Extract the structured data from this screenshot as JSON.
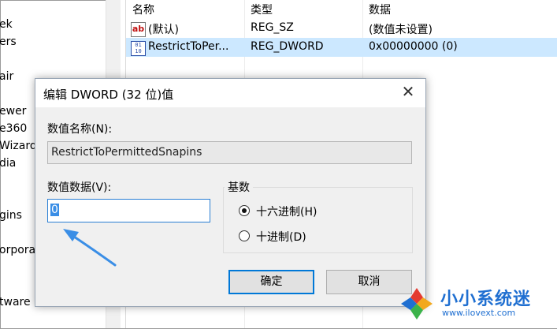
{
  "tree": {
    "items": [
      "ek",
      "ers",
      "air",
      "ewer",
      "e360",
      "Wizard",
      "dia",
      "gins",
      "orporat",
      "tware"
    ]
  },
  "list": {
    "columns": [
      "名称",
      "类型",
      "数据"
    ],
    "rows": [
      {
        "icon": "string-value-icon",
        "name": "(默认)",
        "type": "REG_SZ",
        "data": "(数值未设置)",
        "selected": false
      },
      {
        "icon": "binary-value-icon",
        "name": "RestrictToPer...",
        "type": "REG_DWORD",
        "data": "0x00000000 (0)",
        "selected": true
      }
    ]
  },
  "dialog": {
    "title": "编辑 DWORD (32 位)值",
    "close_glyph": "✕",
    "value_name_label": "数值名称(N):",
    "value_name": "RestrictToPermittedSnapins",
    "value_data_label": "数值数据(V):",
    "value_data": "0",
    "base_label": "基数",
    "radios": [
      {
        "label": "十六进制(H)",
        "checked": true
      },
      {
        "label": "十进制(D)",
        "checked": false
      }
    ],
    "ok_label": "确定",
    "cancel_label": "取消"
  },
  "watermark": {
    "name": "小小系统迷",
    "url": "www.ilovext.com"
  },
  "colors": {
    "selection": "#cce8ff",
    "accent": "#0078d7",
    "arrow": "#3a8ee6",
    "watermark": "#1f6fd1"
  }
}
